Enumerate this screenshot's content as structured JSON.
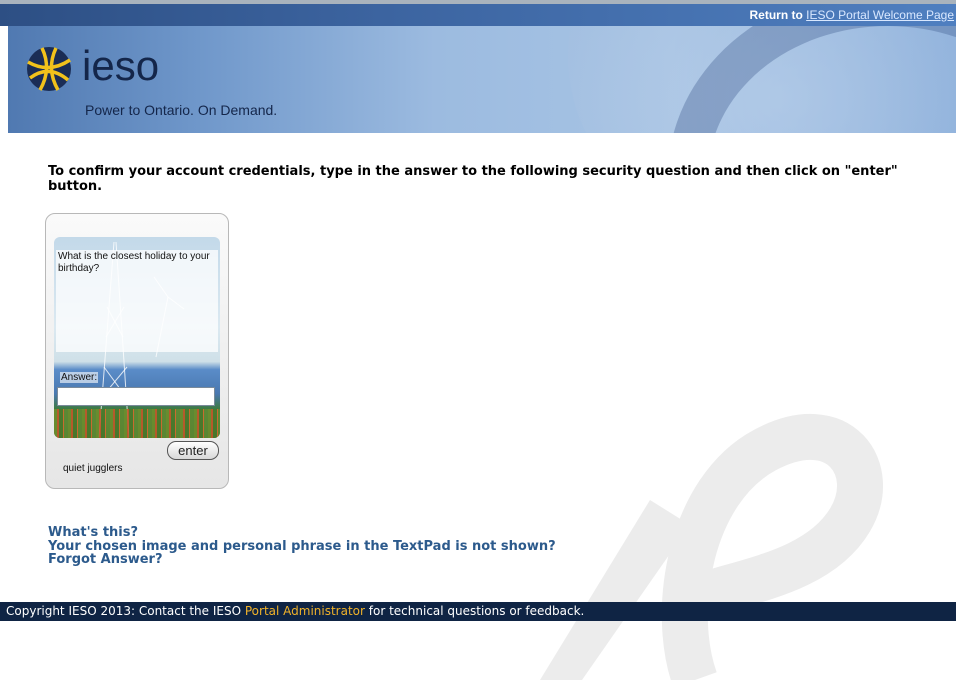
{
  "header": {
    "return_prefix": "Return to",
    "return_link": "IESO Portal Welcome Page",
    "logo_text": "ieso",
    "tagline": "Power to Ontario. On Demand."
  },
  "instructions": "To confirm your account credentials, type in the answer to the following security question and then click on \"enter\" button.",
  "security_pad": {
    "question": "What is the closest holiday to your birthday?",
    "answer_label": "Answer:",
    "answer_value": "",
    "enter_label": "enter",
    "personal_phrase": "quiet jugglers"
  },
  "links": {
    "whats_this": "What's this?",
    "not_shown": "Your chosen image and personal phrase in the TextPad is not shown?",
    "forgot": "Forgot Answer?"
  },
  "footer": {
    "text_before": "Copyright IESO 2013: Contact the IESO ",
    "admin_link": "Portal Administrator",
    "text_after": " for technical questions or feedback."
  },
  "colors": {
    "topbar": "#3c64a0",
    "link": "#2c5a8c",
    "footer": "#0f2444",
    "admin_link": "#f0b22a"
  }
}
